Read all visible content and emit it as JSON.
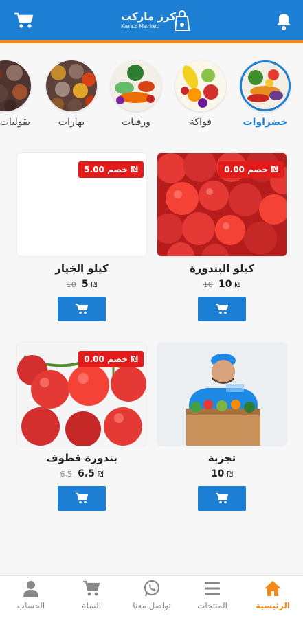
{
  "app": {
    "logo_ar": "كرز ماركت",
    "logo_en": "Karaz Market"
  },
  "colors": {
    "primary": "#1c7fd4",
    "accent": "#f28a1a",
    "discount": "#e31b1b"
  },
  "categories": [
    {
      "label": "خضراوات",
      "icon": "vegetables-image",
      "active": true
    },
    {
      "label": "فواكة",
      "icon": "fruits-image"
    },
    {
      "label": "ورقيات",
      "icon": "leafy-greens-image"
    },
    {
      "label": "بهارات",
      "icon": "spices-image"
    },
    {
      "label": "بقوليات",
      "icon": "legumes-image"
    }
  ],
  "products": [
    {
      "name": "كيلو  البندورة",
      "discount": "خصم 0.00 ₪",
      "price": "10",
      "old_price": "10",
      "currency": "₪"
    },
    {
      "name": "كيلو  الخيار",
      "discount": "خصم 5.00 ₪",
      "price": "5",
      "old_price": "10",
      "currency": "₪"
    },
    {
      "name": "تجربة",
      "price": "10",
      "currency": "₪"
    },
    {
      "name": "بندورة قطوف",
      "discount": "خصم 0.00 ₪",
      "price": "6.5",
      "old_price": "6.5",
      "currency": "₪"
    }
  ],
  "nav": [
    {
      "label": "الرئيسية",
      "icon": "home-icon",
      "active": true
    },
    {
      "label": "المنتجات",
      "icon": "menu-icon"
    },
    {
      "label": "تواصل معنا",
      "icon": "whatsapp-icon"
    },
    {
      "label": "السلة",
      "icon": "cart-icon"
    },
    {
      "label": "الحساب",
      "icon": "user-icon"
    }
  ]
}
